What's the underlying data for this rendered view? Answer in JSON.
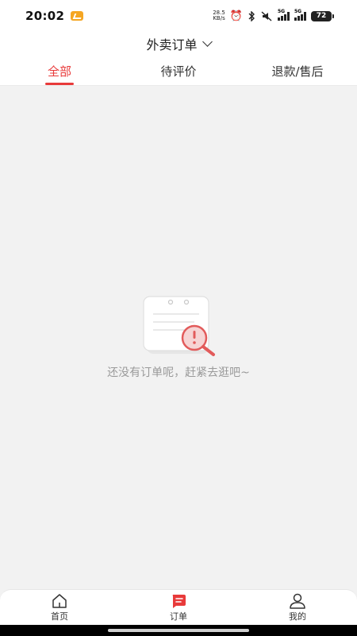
{
  "status_bar": {
    "time": "20:02",
    "net_speed_value": "28.5",
    "net_speed_unit": "KB/s",
    "signal_1": "5G",
    "signal_2": "5G",
    "battery": "72"
  },
  "header": {
    "title": "外卖订单"
  },
  "tabs": [
    {
      "label": "全部",
      "active": true
    },
    {
      "label": "待评价",
      "active": false
    },
    {
      "label": "退款/售后",
      "active": false
    }
  ],
  "empty_state": {
    "message": "还没有订单呢，赶紧去逛吧~"
  },
  "bottom_nav": [
    {
      "label": "首页",
      "icon": "home-icon",
      "active": false
    },
    {
      "label": "订单",
      "icon": "order-icon",
      "active": true
    },
    {
      "label": "我的",
      "icon": "profile-icon",
      "active": false
    }
  ],
  "colors": {
    "accent": "#e83a3a",
    "background": "#f2f2f2"
  }
}
